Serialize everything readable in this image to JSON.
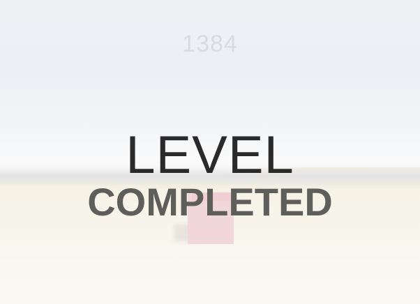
{
  "hud": {
    "score": "1384"
  },
  "overlay": {
    "line1": "LEVEL",
    "line2": "COMPLETED"
  },
  "colors": {
    "sky": "#eef0f4",
    "ground": "#f7f4ea",
    "cube": "#f2d7da",
    "title_level": "#2a2a2a",
    "title_completed": "#5e5e5b",
    "score": "#d9dbdf"
  }
}
